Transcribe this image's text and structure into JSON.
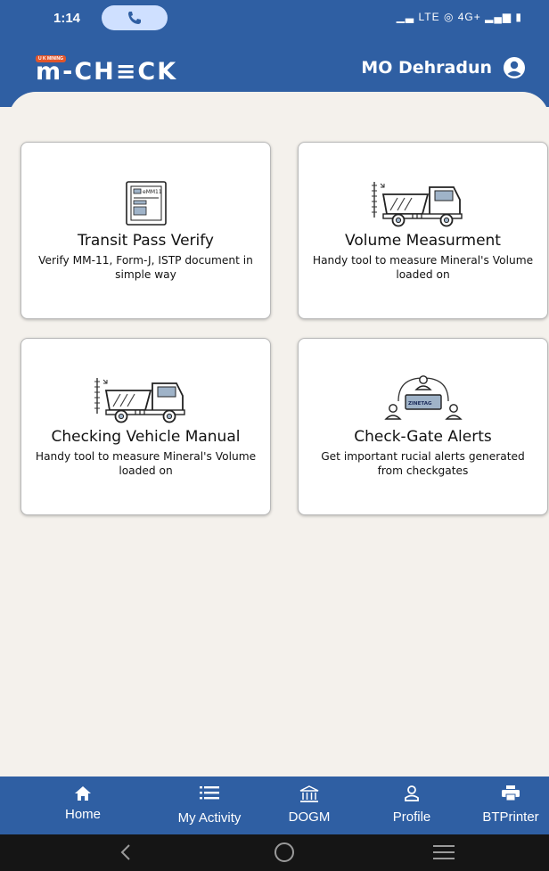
{
  "status_bar": {
    "time": "1:14",
    "indicators": "▁▃ LTE ◎ 4G+ ▂▄▆ ▮",
    "call_icon": "phone-icon"
  },
  "header": {
    "logo_badge": "U K MINING",
    "logo_text": "m-CH≡CK",
    "user_name": "MO Dehradun",
    "user_icon": "account-circle-icon"
  },
  "cards": [
    {
      "title": "Transit Pass Verify",
      "description": "Verify MM-11, Form-J, ISTP document in simple way",
      "icon": "document-emm11-icon",
      "doc_label": "eMM11"
    },
    {
      "title": "Volume Measurment",
      "description": "Handy tool to measure Mineral's Volume loaded on",
      "icon": "dump-truck-icon"
    },
    {
      "title": "Checking Vehicle Manual",
      "description": "Handy tool to measure Mineral's Volume loaded on",
      "icon": "dump-truck-icon"
    },
    {
      "title": "Check-Gate Alerts",
      "description": "Get important rucial alerts generated from checkgates",
      "icon": "checkgate-network-icon",
      "tag_label": "ZINETAG"
    }
  ],
  "bottom_nav": [
    {
      "label": "Home",
      "icon": "home-icon"
    },
    {
      "label": "My Activity",
      "icon": "list-icon"
    },
    {
      "label": "DOGM",
      "icon": "bank-icon"
    },
    {
      "label": "Profile",
      "icon": "person-icon"
    },
    {
      "label": "BTPrinter",
      "icon": "printer-icon"
    }
  ],
  "system_nav": [
    "back-icon",
    "home-circle-icon",
    "menu-icon"
  ],
  "colors": {
    "primary": "#2f5fa3",
    "background": "#f4f1ec",
    "logo_accent": "#e2562b"
  }
}
